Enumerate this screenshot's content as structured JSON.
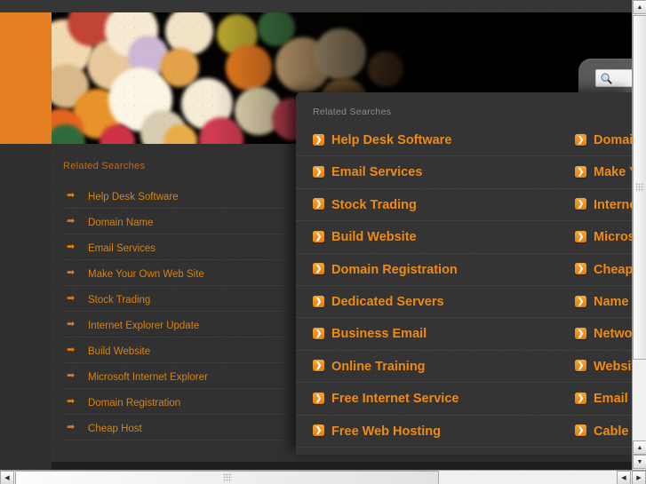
{
  "window": {
    "background_color": "#2f2f2f",
    "accent_color": "#e67e22",
    "link_color": "#f08a12"
  },
  "hero": {
    "name": "bokeh-lights-banner",
    "orange_block_color": "#e67e22"
  },
  "search": {
    "icon": "magnifier-icon",
    "value": "",
    "placeholder": ""
  },
  "sidebar": {
    "title": "Related Searches",
    "bullet_icon": "arrow-right-icon",
    "items": [
      {
        "label": "Help Desk Software"
      },
      {
        "label": "Domain Name"
      },
      {
        "label": "Email Services"
      },
      {
        "label": "Make Your Own Web Site"
      },
      {
        "label": "Stock Trading"
      },
      {
        "label": "Internet Explorer Update"
      },
      {
        "label": "Build Website"
      },
      {
        "label": "Microsoft Internet Explorer"
      },
      {
        "label": "Domain Registration"
      },
      {
        "label": "Cheap Host"
      }
    ]
  },
  "overlay": {
    "title": "Related Searches",
    "bullet_icon": "chevron-right-square-icon",
    "bullet_glyph": "❯",
    "rows": [
      {
        "left": "Help Desk Software",
        "right": "Domain Name"
      },
      {
        "left": "Email Services",
        "right": "Make Your Own Web Site"
      },
      {
        "left": "Stock Trading",
        "right": "Internet Explorer Update"
      },
      {
        "left": "Build Website",
        "right": "Microsoft Internet Explorer"
      },
      {
        "left": "Domain Registration",
        "right": "Cheap Host"
      },
      {
        "left": "Dedicated Servers",
        "right": "Name Servers"
      },
      {
        "left": "Business Email",
        "right": "Network Security"
      },
      {
        "left": "Online Training",
        "right": "Website Design"
      },
      {
        "left": "Free Internet Service",
        "right": "Email Hosting"
      },
      {
        "left": "Free Web Hosting",
        "right": "Cable TV"
      }
    ]
  },
  "scrollbars": {
    "vertical": {
      "up_glyph": "▲",
      "down_glyph": "▼"
    },
    "horizontal": {
      "left_glyph": "◀",
      "right_glyph": "▶"
    }
  }
}
